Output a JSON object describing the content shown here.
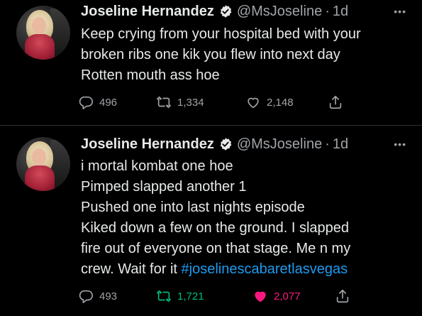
{
  "tweets": [
    {
      "author": {
        "name": "Joseline Hernandez",
        "handle": "@MsJoseline",
        "time": "1d"
      },
      "text_lines": [
        "Keep crying from your hospital bed with your",
        "broken ribs one kik you flew into next day",
        "Rotten mouth ass hoe"
      ],
      "hashtag": "",
      "stats": {
        "replies": "496",
        "retweets": "1,334",
        "likes": "2,148"
      },
      "liked": false,
      "retweeted": false
    },
    {
      "author": {
        "name": "Joseline Hernandez",
        "handle": "@MsJoseline",
        "time": "1d"
      },
      "text_lines": [
        "i mortal kombat one hoe",
        "Pimped slapped another 1",
        "Pushed one into last nights episode",
        "Kiked down a few on the ground. I slapped",
        "fire out of everyone on that stage. Me n my",
        "crew. Wait for it"
      ],
      "hashtag": "#joselinescabaretlasvegas",
      "stats": {
        "replies": "493",
        "retweets": "1,721",
        "likes": "2,077"
      },
      "liked": true,
      "retweeted": true
    }
  ],
  "ui": {
    "dot": "·",
    "more": "•••"
  },
  "icons": {
    "verified": "verified-badge-icon",
    "reply": "reply-icon",
    "retweet": "retweet-icon",
    "like": "heart-icon",
    "share": "share-icon",
    "more": "more-options-icon"
  },
  "colors": {
    "background": "#000000",
    "text": "#e7e9ea",
    "muted": "#a0a4a8",
    "link": "#1d9bf0",
    "like": "#f91880",
    "retweet": "#00ba7c"
  }
}
